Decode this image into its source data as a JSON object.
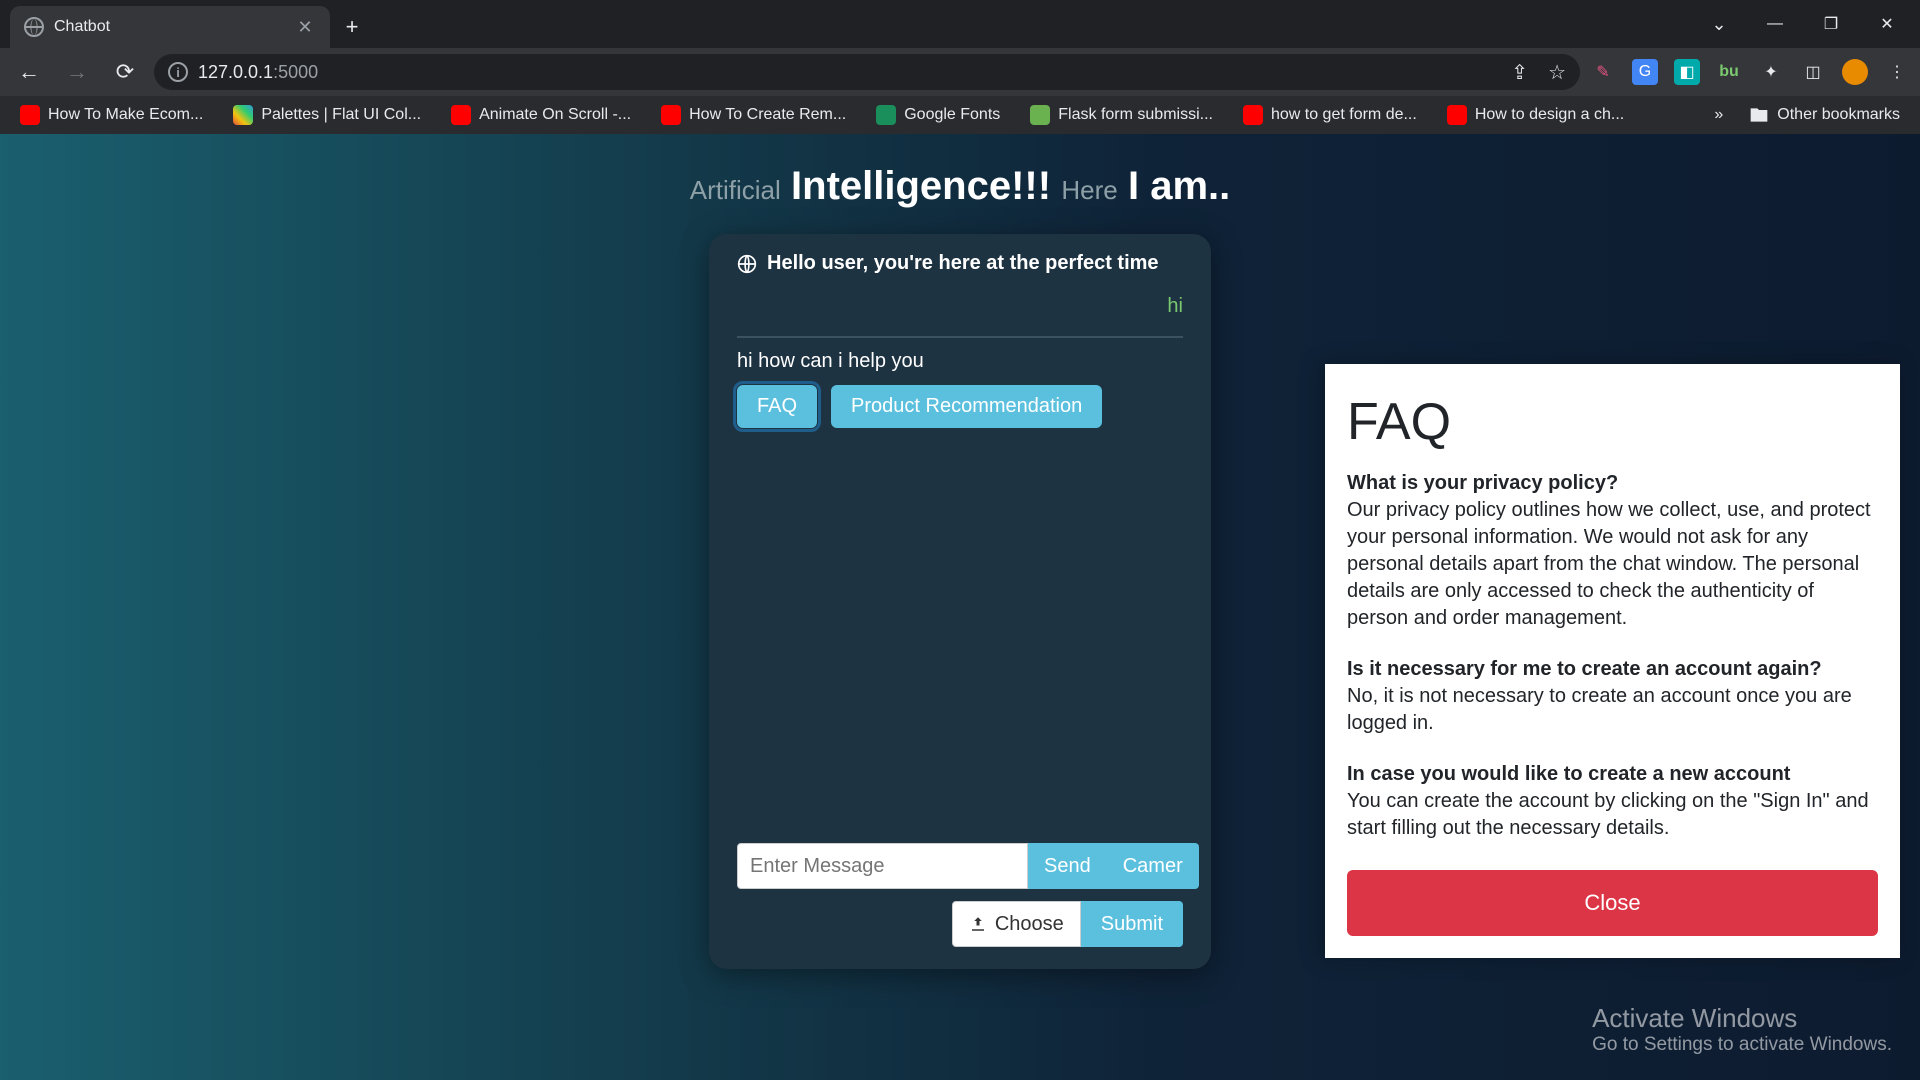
{
  "chrome": {
    "tab_title": "Chatbot",
    "url_host": "127.0.0.1",
    "url_path": ":5000",
    "bookmarks": [
      {
        "label": "How To Make Ecom...",
        "type": "yt"
      },
      {
        "label": "Palettes | Flat UI Col...",
        "type": "pal"
      },
      {
        "label": "Animate On Scroll -...",
        "type": "yt"
      },
      {
        "label": "How To Create Rem...",
        "type": "yt"
      },
      {
        "label": "Google Fonts",
        "type": "gf"
      },
      {
        "label": "Flask form submissi...",
        "type": "fl"
      },
      {
        "label": "how to get form de...",
        "type": "yt"
      },
      {
        "label": "How to design a ch...",
        "type": "yt"
      }
    ],
    "other_bookmarks": "Other bookmarks"
  },
  "page_title": {
    "muted1": "Artificial",
    "big": "Intelligence!!!",
    "muted2": "Here",
    "rest": "I am.."
  },
  "chat": {
    "header": "Hello user, you're here at the perfect time",
    "messages": {
      "user1": "hi",
      "bot1": "hi how can i help you",
      "btn_faq": "FAQ",
      "btn_prodrec": "Product Recommendation"
    },
    "input_placeholder": "Enter Message",
    "btn_send": "Send",
    "btn_camer": "Camer",
    "btn_choose": "Choose",
    "btn_submit": "Submit"
  },
  "faq": {
    "title": "FAQ",
    "items": [
      {
        "q": "What is your privacy policy?",
        "a": "Our privacy policy outlines how we collect, use, and protect your personal information.\nWe would not ask for any personal details apart from the chat window.\nThe personal details are only accessed to check the authenticity of person and order management."
      },
      {
        "q": "Is it necessary for me to create an account again?",
        "a": "No, it is not necessary to create an account once you are logged in."
      },
      {
        "q": "In case you would like to create a new account",
        "a": "You can create the account by clicking on the \"Sign In\" and start filling out the necessary details."
      }
    ],
    "close": "Close"
  },
  "watermark": {
    "line1": "Activate Windows",
    "line2": "Go to Settings to activate Windows."
  }
}
